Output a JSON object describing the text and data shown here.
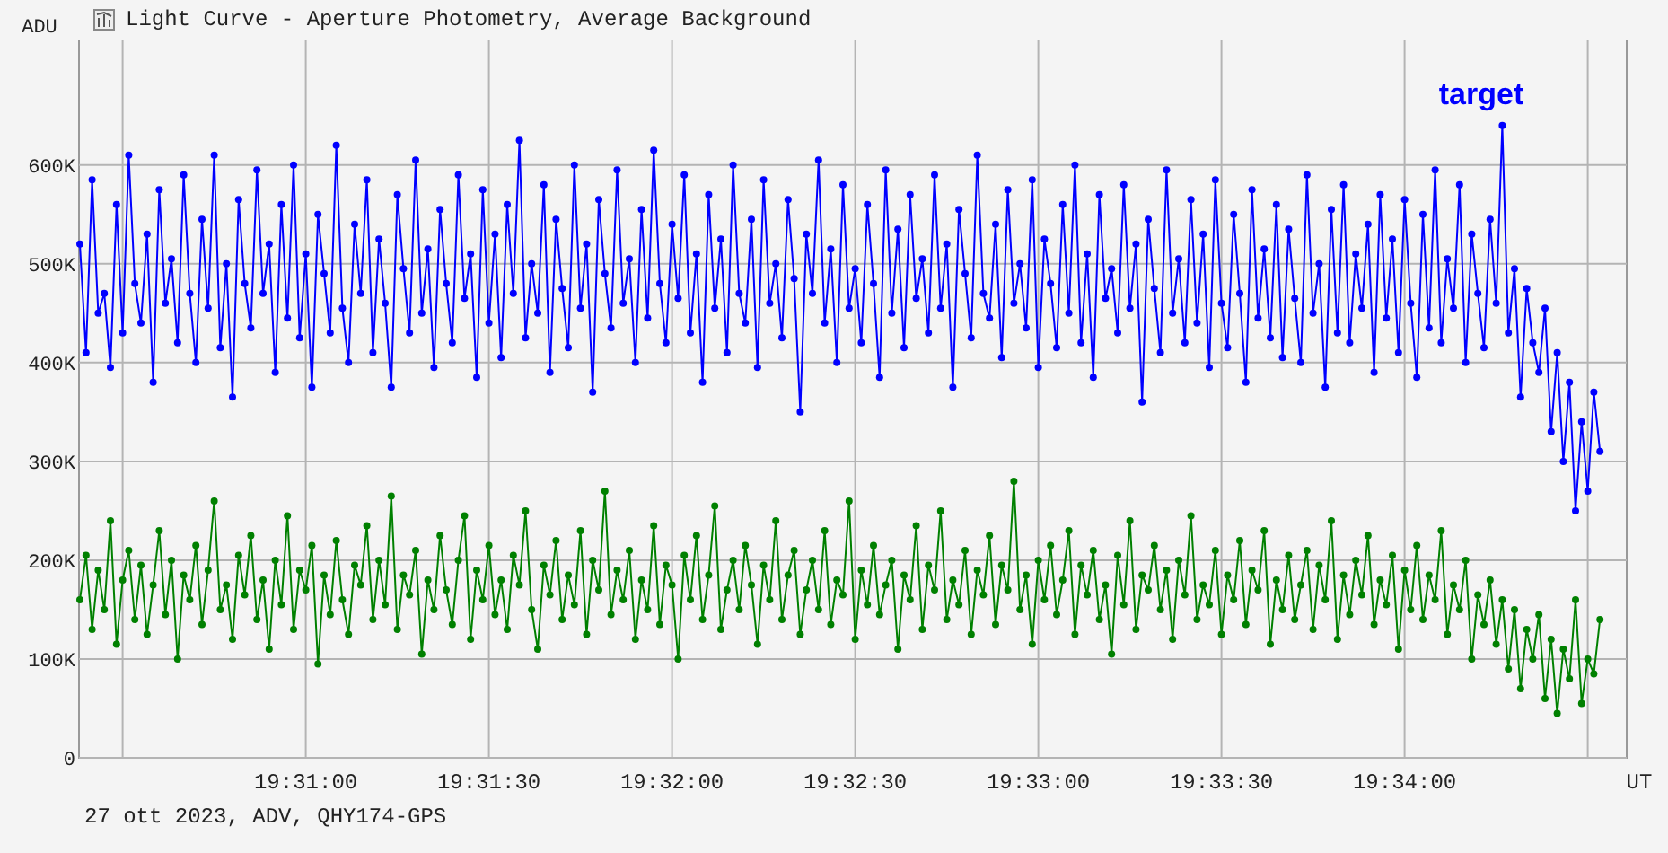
{
  "window": {
    "title": "Light Curve - Aperture Photometry, Average Background"
  },
  "chart_data": {
    "type": "line",
    "grid": true,
    "xlabel": "UT",
    "ylabel": "ADU",
    "ylim": [
      0,
      727000
    ],
    "categories": [
      null,
      null,
      null,
      null,
      null,
      null,
      null,
      null,
      null,
      null,
      null,
      null,
      null,
      null,
      null,
      null,
      null,
      null,
      null,
      null,
      null,
      null,
      null,
      null,
      null,
      null,
      null,
      null,
      null,
      null,
      null,
      null,
      null,
      null,
      null,
      null,
      null,
      "19:31:00",
      null,
      null,
      null,
      null,
      null,
      null,
      null,
      null,
      null,
      null,
      null,
      null,
      null,
      null,
      null,
      null,
      null,
      null,
      null,
      null,
      null,
      null,
      null,
      null,
      null,
      null,
      null,
      null,
      null,
      "19:31:30",
      null,
      null,
      null,
      null,
      null,
      null,
      null,
      null,
      null,
      null,
      null,
      null,
      null,
      null,
      null,
      null,
      null,
      null,
      null,
      null,
      null,
      null,
      null,
      null,
      null,
      null,
      null,
      null,
      null,
      "19:32:00",
      null,
      null,
      null,
      null,
      null,
      null,
      null,
      null,
      null,
      null,
      null,
      null,
      null,
      null,
      null,
      null,
      null,
      null,
      null,
      null,
      null,
      null,
      null,
      null,
      null,
      null,
      null,
      null,
      null,
      "19:32:30",
      null,
      null,
      null,
      null,
      null,
      null,
      null,
      null,
      null,
      null,
      null,
      null,
      null,
      null,
      null,
      null,
      null,
      null,
      null,
      null,
      null,
      null,
      null,
      null,
      null,
      null,
      null,
      null,
      null,
      "19:33:00",
      null,
      null,
      null,
      null,
      null,
      null,
      null,
      null,
      null,
      null,
      null,
      null,
      null,
      null,
      null,
      null,
      null,
      null,
      null,
      null,
      null,
      null,
      null,
      null,
      null,
      null,
      null,
      null,
      null,
      "19:33:30",
      null,
      null,
      null,
      null,
      null,
      null,
      null,
      null,
      null,
      null,
      null,
      null,
      null,
      null,
      null,
      null,
      null,
      null,
      null,
      null,
      null,
      null,
      null,
      null,
      null,
      null,
      null,
      null,
      null,
      "19:34:00",
      null,
      null,
      null,
      null,
      null,
      null,
      null,
      null,
      null,
      null,
      null,
      null,
      null,
      null,
      null,
      null,
      null,
      null,
      null,
      null,
      null,
      null,
      null,
      null,
      null,
      null,
      null,
      null,
      null,
      null,
      null,
      null
    ],
    "yticks": [
      {
        "value": 0,
        "label": "0"
      },
      {
        "value": 100000,
        "label": "100K"
      },
      {
        "value": 200000,
        "label": "200K"
      },
      {
        "value": 300000,
        "label": "300K"
      },
      {
        "value": 400000,
        "label": "400K"
      },
      {
        "value": 500000,
        "label": "500K"
      },
      {
        "value": 600000,
        "label": "600K"
      }
    ],
    "series": [
      {
        "name": "target",
        "color": "#0000ff",
        "marker": "o",
        "values": [
          520000,
          410000,
          585000,
          450000,
          470000,
          395000,
          560000,
          430000,
          610000,
          480000,
          440000,
          530000,
          380000,
          575000,
          460000,
          505000,
          420000,
          590000,
          470000,
          400000,
          545000,
          455000,
          610000,
          415000,
          500000,
          365000,
          565000,
          480000,
          435000,
          595000,
          470000,
          520000,
          390000,
          560000,
          445000,
          600000,
          425000,
          510000,
          375000,
          550000,
          490000,
          430000,
          620000,
          455000,
          400000,
          540000,
          470000,
          585000,
          410000,
          525000,
          460000,
          375000,
          570000,
          495000,
          430000,
          605000,
          450000,
          515000,
          395000,
          555000,
          480000,
          420000,
          590000,
          465000,
          510000,
          385000,
          575000,
          440000,
          530000,
          405000,
          560000,
          470000,
          625000,
          425000,
          500000,
          450000,
          580000,
          390000,
          545000,
          475000,
          415000,
          600000,
          455000,
          520000,
          370000,
          565000,
          490000,
          435000,
          595000,
          460000,
          505000,
          400000,
          555000,
          445000,
          615000,
          480000,
          420000,
          540000,
          465000,
          590000,
          430000,
          510000,
          380000,
          570000,
          455000,
          525000,
          410000,
          600000,
          470000,
          440000,
          545000,
          395000,
          585000,
          460000,
          500000,
          425000,
          565000,
          485000,
          350000,
          530000,
          470000,
          605000,
          440000,
          515000,
          400000,
          580000,
          455000,
          495000,
          420000,
          560000,
          480000,
          385000,
          595000,
          450000,
          535000,
          415000,
          570000,
          465000,
          505000,
          430000,
          590000,
          455000,
          520000,
          375000,
          555000,
          490000,
          425000,
          610000,
          470000,
          445000,
          540000,
          405000,
          575000,
          460000,
          500000,
          435000,
          585000,
          395000,
          525000,
          480000,
          415000,
          560000,
          450000,
          600000,
          420000,
          510000,
          385000,
          570000,
          465000,
          495000,
          430000,
          580000,
          455000,
          520000,
          360000,
          545000,
          475000,
          410000,
          595000,
          450000,
          505000,
          420000,
          565000,
          440000,
          530000,
          395000,
          585000,
          460000,
          415000,
          550000,
          470000,
          380000,
          575000,
          445000,
          515000,
          425000,
          560000,
          405000,
          535000,
          465000,
          400000,
          590000,
          450000,
          500000,
          375000,
          555000,
          430000,
          580000,
          420000,
          510000,
          455000,
          540000,
          390000,
          570000,
          445000,
          525000,
          410000,
          565000,
          460000,
          385000,
          550000,
          435000,
          595000,
          420000,
          505000,
          455000,
          580000,
          400000,
          530000,
          470000,
          415000,
          545000,
          460000,
          640000,
          430000,
          495000,
          365000,
          475000,
          420000,
          390000,
          455000,
          330000,
          410000,
          300000,
          380000,
          250000,
          340000,
          270000,
          370000,
          310000
        ]
      },
      {
        "color": "#008000",
        "marker": "o",
        "values": [
          160000,
          205000,
          130000,
          190000,
          150000,
          240000,
          115000,
          180000,
          210000,
          140000,
          195000,
          125000,
          175000,
          230000,
          145000,
          200000,
          100000,
          185000,
          160000,
          215000,
          135000,
          190000,
          260000,
          150000,
          175000,
          120000,
          205000,
          165000,
          225000,
          140000,
          180000,
          110000,
          200000,
          155000,
          245000,
          130000,
          190000,
          170000,
          215000,
          95000,
          185000,
          145000,
          220000,
          160000,
          125000,
          195000,
          175000,
          235000,
          140000,
          200000,
          155000,
          265000,
          130000,
          185000,
          165000,
          210000,
          105000,
          180000,
          150000,
          225000,
          170000,
          135000,
          200000,
          245000,
          120000,
          190000,
          160000,
          215000,
          145000,
          180000,
          130000,
          205000,
          175000,
          250000,
          150000,
          110000,
          195000,
          165000,
          220000,
          140000,
          185000,
          155000,
          230000,
          125000,
          200000,
          170000,
          270000,
          145000,
          190000,
          160000,
          210000,
          120000,
          180000,
          150000,
          235000,
          135000,
          195000,
          175000,
          100000,
          205000,
          160000,
          225000,
          140000,
          185000,
          255000,
          130000,
          170000,
          200000,
          150000,
          215000,
          175000,
          115000,
          195000,
          160000,
          240000,
          140000,
          185000,
          210000,
          125000,
          170000,
          200000,
          150000,
          230000,
          135000,
          180000,
          165000,
          260000,
          120000,
          190000,
          155000,
          215000,
          145000,
          175000,
          200000,
          110000,
          185000,
          160000,
          235000,
          130000,
          195000,
          170000,
          250000,
          140000,
          180000,
          155000,
          210000,
          125000,
          190000,
          165000,
          225000,
          135000,
          195000,
          170000,
          280000,
          150000,
          185000,
          115000,
          200000,
          160000,
          215000,
          145000,
          180000,
          230000,
          125000,
          195000,
          165000,
          210000,
          140000,
          175000,
          105000,
          205000,
          155000,
          240000,
          130000,
          185000,
          170000,
          215000,
          150000,
          190000,
          120000,
          200000,
          165000,
          245000,
          140000,
          175000,
          155000,
          210000,
          125000,
          185000,
          160000,
          220000,
          135000,
          190000,
          170000,
          230000,
          115000,
          180000,
          150000,
          205000,
          140000,
          175000,
          210000,
          130000,
          195000,
          160000,
          240000,
          120000,
          185000,
          145000,
          200000,
          165000,
          225000,
          135000,
          180000,
          155000,
          205000,
          110000,
          190000,
          150000,
          215000,
          140000,
          185000,
          160000,
          230000,
          125000,
          175000,
          150000,
          200000,
          100000,
          165000,
          135000,
          180000,
          115000,
          160000,
          90000,
          150000,
          70000,
          130000,
          100000,
          145000,
          60000,
          120000,
          45000,
          110000,
          80000,
          160000,
          55000,
          100000,
          85000,
          140000
        ]
      }
    ]
  },
  "footer": "27 ott 2023, ADV, QHY174-GPS"
}
